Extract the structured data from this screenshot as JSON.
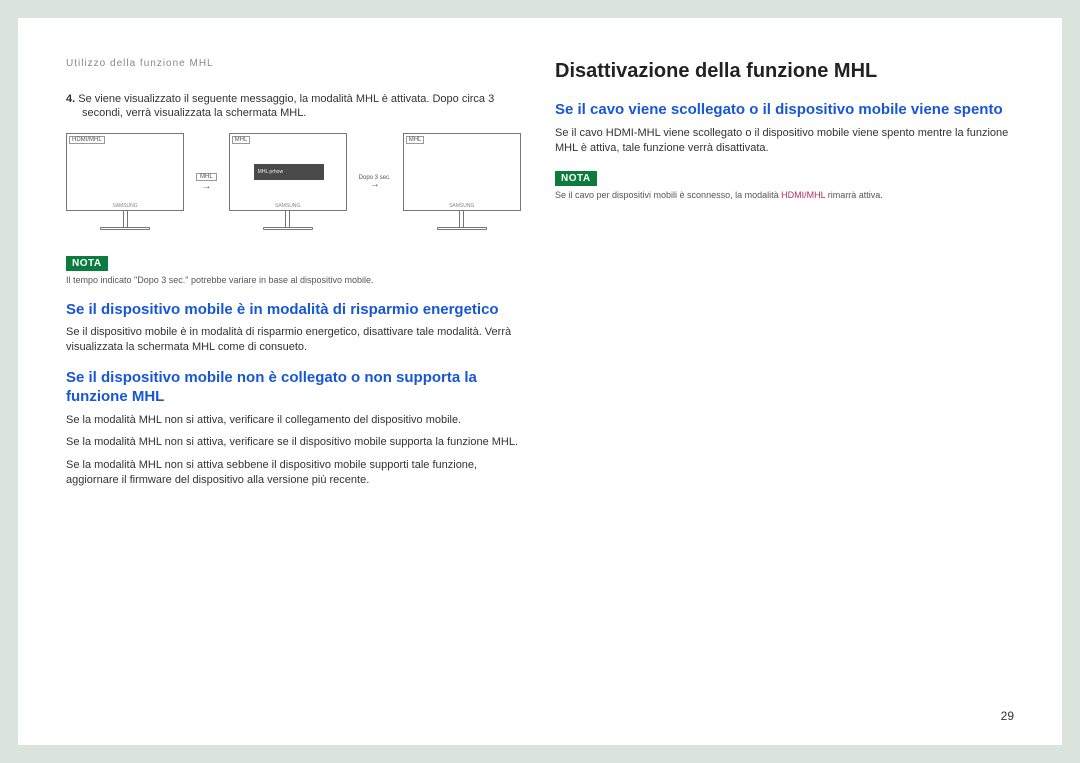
{
  "header": {
    "path": "Utilizzo della funzione MHL"
  },
  "left": {
    "step4_num": "4.",
    "step4_a": "Se viene visualizzato il seguente messaggio, la modalità MHL è attivata. Dopo circa 3",
    "step4_b": "secondi, verrà visualizzata la schermata MHL.",
    "diagram": {
      "mon1_tag": "HDMI/MHL",
      "arrow1_label": "MHL",
      "mon2_tag": "MHL",
      "mon2_msg": "MHL prhow",
      "arrow2_label": "Dopo 3 sec.",
      "mon3_tag": "MHL",
      "brand": "SAMSUNG"
    },
    "nota_label": "NOTA",
    "nota1": "Il tempo indicato \"Dopo 3 sec.\" potrebbe variare in base al dispositivo mobile.",
    "h_power": "Se il dispositivo mobile è in modalità di risparmio energetico",
    "p_power": "Se il dispositivo mobile è in modalità di risparmio energetico, disattivare tale modalità. Verrà visualizzata la schermata MHL come di consueto.",
    "h_unsupp": "Se il dispositivo mobile non è collegato o non supporta la funzione MHL",
    "p_unsupp_1": "Se la modalità MHL non si attiva, verificare il collegamento del dispositivo mobile.",
    "p_unsupp_2": "Se la modalità MHL non si attiva, verificare se il dispositivo mobile supporta la funzione MHL.",
    "p_unsupp_3": "Se la modalità MHL non si attiva sebbene il dispositivo mobile supporti tale funzione, aggiornare il firmware del dispositivo alla versione più recente."
  },
  "right": {
    "h_main": "Disattivazione della funzione MHL",
    "h_cable": "Se il cavo viene scollegato o il dispositivo mobile viene spento",
    "p_cable": "Se il cavo HDMI-MHL viene scollegato o il dispositivo mobile viene spento mentre la funzione MHL è attiva, tale funzione verrà disattivata.",
    "nota_label": "NOTA",
    "nota2_pre": "Se il cavo per dispositivi mobili è sconnesso, la modalità ",
    "nota2_hl": "HDMI/MHL",
    "nota2_post": " rimarrà attiva."
  },
  "page_number": "29"
}
